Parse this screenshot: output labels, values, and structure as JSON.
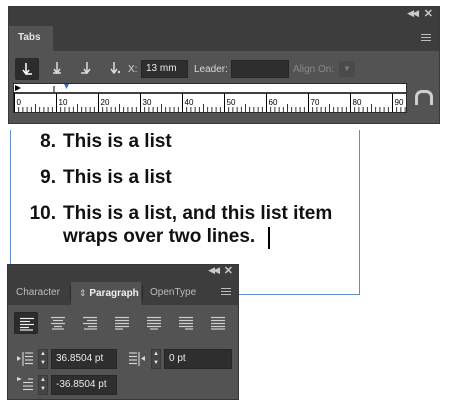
{
  "tabs_panel": {
    "title": "Tabs",
    "toolbar": {
      "x_label": "X:",
      "x_value": "13 mm",
      "leader_label": "Leader:",
      "leader_value": "",
      "align_on_label": "Align On:",
      "buttons": [
        {
          "name": "left-justified-tab-button",
          "icon": "arrow-down-right",
          "active": true
        },
        {
          "name": "center-justified-tab-button",
          "icon": "arrow-down-bar",
          "active": false
        },
        {
          "name": "right-justified-tab-button",
          "icon": "arrow-down-left",
          "active": false
        },
        {
          "name": "align-to-decimal-tab-button",
          "icon": "arrow-down-dot",
          "active": false
        }
      ]
    },
    "ruler": {
      "labels": [
        "0",
        "10",
        "20",
        "30",
        "40",
        "50",
        "60",
        "70",
        "80",
        "90"
      ]
    },
    "icons": [
      "collapse-icon",
      "close-icon",
      "panel-menu-icon",
      "position-panel-above-frame-icon"
    ]
  },
  "text_frame": {
    "items": [
      {
        "number": "8.",
        "lines": [
          "This is a list"
        ]
      },
      {
        "number": "9.",
        "lines": [
          "This is a list"
        ]
      },
      {
        "number": "10.",
        "lines": [
          "This is a list, and this list item",
          "wraps over two lines."
        ]
      }
    ],
    "frame_color": "#5b8fd0"
  },
  "paragraph_panel": {
    "tabs": [
      {
        "label": "Character",
        "active": false
      },
      {
        "label": "Paragraph",
        "active": true,
        "marker": "⇕"
      },
      {
        "label": "OpenType",
        "active": false
      }
    ],
    "alignment_buttons": [
      {
        "name": "align-left",
        "active": true
      },
      {
        "name": "align-center",
        "active": false
      },
      {
        "name": "align-right",
        "active": false
      },
      {
        "name": "justify-last-left",
        "active": false
      },
      {
        "name": "justify-last-center",
        "active": false
      },
      {
        "name": "justify-last-right",
        "active": false
      },
      {
        "name": "justify-all",
        "active": false
      }
    ],
    "left_indent": "36.8504 pt",
    "right_indent": "0 pt",
    "first_line_indent": "-36.8504 pt"
  },
  "colors": {
    "panel_bg": "#535353",
    "panel_chrome": "#3d3d3d",
    "field_bg": "#2e2e2e",
    "accent_tab_stop": "#3a6fb5"
  }
}
